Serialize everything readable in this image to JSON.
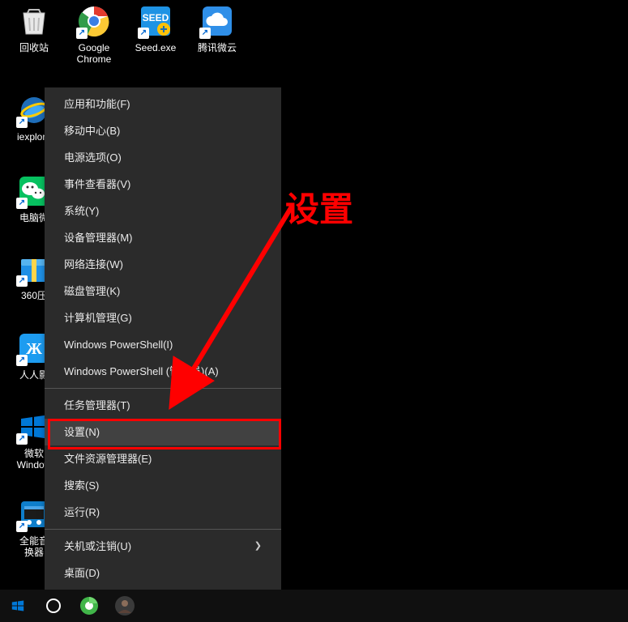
{
  "desktop_icons": {
    "recycle_bin": "回收站",
    "chrome": "Google Chrome",
    "seed": "Seed.exe",
    "weiyun": "腾讯微云",
    "iexplore": "iexplore",
    "wechat_pc": "电脑微",
    "zip360": "360压",
    "renren": "人人影",
    "win_soft": "微软\nWindow",
    "audio_conv": "全能音\n换器"
  },
  "context_menu": {
    "apps_features": "应用和功能(F)",
    "mobility_center": "移动中心(B)",
    "power_options": "电源选项(O)",
    "event_viewer": "事件查看器(V)",
    "system": "系统(Y)",
    "device_manager": "设备管理器(M)",
    "network_connections": "网络连接(W)",
    "disk_management": "磁盘管理(K)",
    "computer_management": "计算机管理(G)",
    "powershell": "Windows PowerShell(I)",
    "powershell_admin": "Windows PowerShell (管理员)(A)",
    "task_manager": "任务管理器(T)",
    "settings": "设置(N)",
    "file_explorer": "文件资源管理器(E)",
    "search": "搜索(S)",
    "run": "运行(R)",
    "shutdown_signout": "关机或注销(U)",
    "desktop": "桌面(D)"
  },
  "annotation": {
    "label": "设置"
  }
}
